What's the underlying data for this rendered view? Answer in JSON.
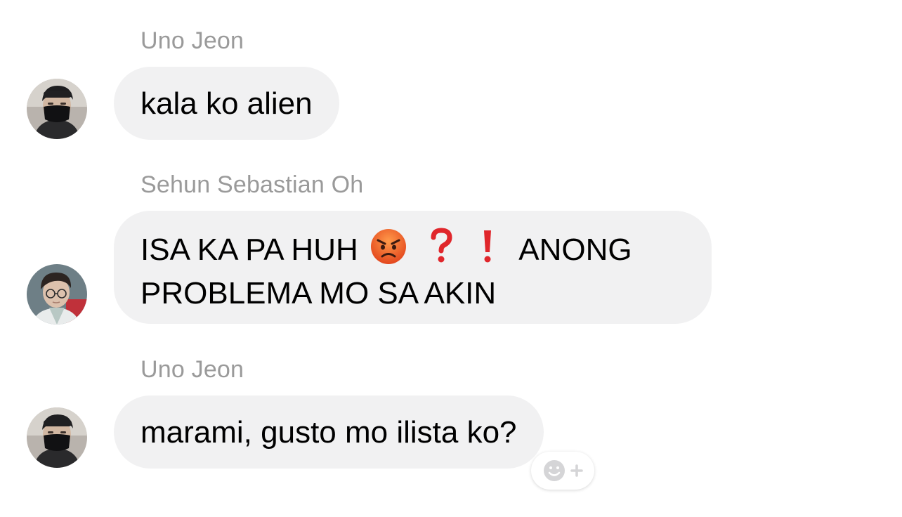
{
  "messages": [
    {
      "sender": "Uno Jeon",
      "text": "kala ko alien",
      "avatar_icon": "masked-person-avatar"
    },
    {
      "sender": "Sehun Sebastian Oh",
      "text_part1": "ISA KA PA HUH",
      "emojis": [
        "angry-face-emoji",
        "red-question-mark-emoji",
        "red-exclamation-mark-emoji"
      ],
      "text_part2": "ANONG",
      "text_line2": "PROBLEMA MO SA AKIN",
      "avatar_icon": "glasses-person-avatar"
    },
    {
      "sender": "Uno Jeon",
      "text": "marami, gusto mo ilista ko?",
      "avatar_icon": "masked-person-avatar"
    }
  ],
  "reaction_button": {
    "icon": "add-reaction-smiley-icon"
  },
  "colors": {
    "bubble": "#f1f1f2",
    "sender_text": "#9a9a9a",
    "message_text": "#000000",
    "emoji_red": "#e0262b"
  }
}
